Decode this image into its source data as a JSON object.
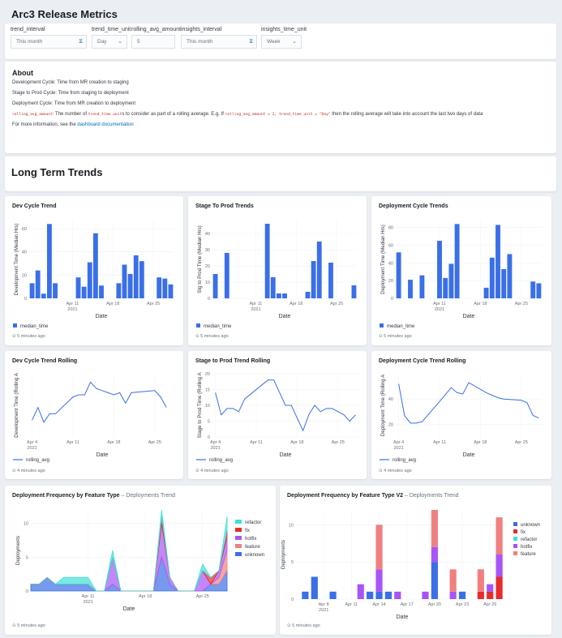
{
  "app_title": "Arc3 Release Metrics",
  "controls": [
    {
      "label": "trend_interval",
      "value": "This month",
      "kind": "date"
    },
    {
      "label": "trend_time_unit",
      "value": "Day",
      "kind": "select"
    },
    {
      "label": "rolling_avg_amount",
      "value": "5",
      "kind": "number"
    },
    {
      "label": "insights_interval",
      "value": "This month",
      "kind": "date"
    },
    {
      "label": "insights_time_unit",
      "value": "Week",
      "kind": "select"
    }
  ],
  "about": {
    "heading": "About",
    "line1": "Development Cycle: Time from MR creation to staging",
    "line2": "Stage to Prod Cycle: Time from staging to deployment",
    "line3": "Deployment Cycle: Time from MR creation to deployment",
    "code1": "rolling_avg_amount",
    "line4a": ": The number of ",
    "code2": "trend_time_unit",
    "line4b": "s to consider as part of a rolling average. E.g. If ",
    "code3": "rolling_avg_amount = 2, trend_time_unit = \"Day\"",
    "line4c": " then the rolling average will take into account the last two days of data",
    "line5a": "For more information, see the ",
    "link": "dashboard documentation"
  },
  "section_title": "Long Term Trends",
  "icons": {
    "date": "calendar-icon",
    "select": "chevron-down-icon",
    "time": "clock-icon"
  },
  "colors": {
    "bar": "#3a6fe8",
    "line": "#3a6fe8",
    "refactor": "#40e0d8",
    "fix": "#e62c2c",
    "hotfix": "#a855f7",
    "feature": "#f08080",
    "unknown": "#3a6fe8"
  },
  "charts": [
    {
      "title": "Dev Cycle Trend",
      "foot": "5 minutes ago",
      "ylabel": "Development Time (Median Hrs)",
      "xlabel": "Date",
      "legend": "median_time",
      "ticks": [
        0,
        20,
        40,
        60
      ],
      "chart_data": {
        "type": "bar",
        "x": [
          "2021-04-04",
          "2021-04-05",
          "2021-04-06",
          "2021-04-07",
          "2021-04-08",
          "2021-04-09",
          "2021-04-10",
          "2021-04-11",
          "2021-04-12",
          "2021-04-13",
          "2021-04-14",
          "2021-04-15",
          "2021-04-16",
          "2021-04-17",
          "2021-04-18",
          "2021-04-19",
          "2021-04-20",
          "2021-04-21",
          "2021-04-22",
          "2021-04-23",
          "2021-04-24",
          "2021-04-25",
          "2021-04-26",
          "2021-04-27",
          "2021-04-28"
        ],
        "values": [
          13,
          24,
          4,
          64,
          13,
          0,
          0,
          0,
          18,
          10,
          31,
          56,
          11,
          0,
          0,
          13,
          29,
          21,
          37,
          32,
          0,
          0,
          18,
          17,
          12
        ],
        "ylim": [
          0,
          67
        ]
      }
    },
    {
      "title": "Stage To Prod Trends",
      "foot": "5 minutes ago",
      "ylabel": "Stg to Prod Time (Median Hrs)",
      "xlabel": "Date",
      "legend": "median_time",
      "ticks": [
        0,
        10,
        20,
        30,
        40
      ],
      "chart_data": {
        "type": "bar",
        "x": [
          "2021-04-04",
          "2021-04-05",
          "2021-04-06",
          "2021-04-07",
          "2021-04-08",
          "2021-04-09",
          "2021-04-10",
          "2021-04-11",
          "2021-04-12",
          "2021-04-13",
          "2021-04-14",
          "2021-04-15",
          "2021-04-16",
          "2021-04-17",
          "2021-04-18",
          "2021-04-19",
          "2021-04-20",
          "2021-04-21",
          "2021-04-22",
          "2021-04-23",
          "2021-04-24",
          "2021-04-25",
          "2021-04-26",
          "2021-04-27",
          "2021-04-28"
        ],
        "values": [
          15,
          0,
          28,
          0,
          0,
          0,
          0,
          0,
          0,
          46,
          13,
          3,
          3,
          0,
          0,
          0,
          4,
          23,
          35,
          0,
          22,
          0,
          0,
          0,
          8
        ],
        "ylim": [
          0,
          48
        ]
      }
    },
    {
      "title": "Deployment Cycle Trends",
      "foot": "5 minutes ago",
      "ylabel": "Deployment Time (Median Hrs)",
      "xlabel": "Date",
      "legend": "median_time",
      "ticks": [
        0,
        20,
        40,
        60,
        80
      ],
      "chart_data": {
        "type": "bar",
        "x": [
          "2021-04-04",
          "2021-04-05",
          "2021-04-06",
          "2021-04-07",
          "2021-04-08",
          "2021-04-09",
          "2021-04-10",
          "2021-04-11",
          "2021-04-12",
          "2021-04-13",
          "2021-04-14",
          "2021-04-15",
          "2021-04-16",
          "2021-04-17",
          "2021-04-18",
          "2021-04-19",
          "2021-04-20",
          "2021-04-21",
          "2021-04-22",
          "2021-04-23",
          "2021-04-24",
          "2021-04-25",
          "2021-04-26",
          "2021-04-27",
          "2021-04-28"
        ],
        "values": [
          52,
          0,
          21,
          0,
          26,
          0,
          0,
          65,
          23,
          39,
          84,
          0,
          0,
          0,
          0,
          12,
          46,
          83,
          33,
          50,
          0,
          0,
          0,
          19,
          17
        ],
        "ylim": [
          0,
          88
        ]
      }
    },
    {
      "title": "Dev Cycle Trend Rolling",
      "foot": "4 minutes ago",
      "ylabel": "Development Time (Rolling A",
      "xlabel": "Date",
      "legend": "rolling_avg",
      "ticks": [],
      "chart_data": {
        "type": "line",
        "x": [
          "2021-04-04",
          "2021-04-05",
          "2021-04-06",
          "2021-04-07",
          "2021-04-08",
          "2021-04-11",
          "2021-04-12",
          "2021-04-13",
          "2021-04-14",
          "2021-04-15",
          "2021-04-18",
          "2021-04-19",
          "2021-04-20",
          "2021-04-21",
          "2021-04-25",
          "2021-04-26",
          "2021-04-27"
        ],
        "values": [
          13,
          19,
          12,
          16,
          16,
          24,
          25,
          25,
          31,
          28,
          25,
          26,
          21,
          26,
          27,
          24,
          19
        ],
        "ylim": [
          5,
          35
        ]
      }
    },
    {
      "title": "Stage to Prod Trend Rolling",
      "foot": "4 minutes ago",
      "ylabel": "Stage to Prod Time (Rolling A",
      "xlabel": "Date",
      "legend": "rolling_avg",
      "ticks": [
        0,
        5,
        10,
        15,
        20
      ],
      "chart_data": {
        "type": "line",
        "x": [
          "2021-04-04",
          "2021-04-05",
          "2021-04-06",
          "2021-04-07",
          "2021-04-08",
          "2021-04-09",
          "2021-04-13",
          "2021-04-14",
          "2021-04-15",
          "2021-04-16",
          "2021-04-17",
          "2021-04-19",
          "2021-04-20",
          "2021-04-21",
          "2021-04-22",
          "2021-04-23",
          "2021-04-24",
          "2021-04-25",
          "2021-04-26",
          "2021-04-27",
          "2021-04-28"
        ],
        "values": [
          14,
          7,
          9,
          9,
          8,
          12,
          18,
          18,
          14,
          10,
          10,
          2,
          7,
          10,
          8,
          9,
          9,
          8,
          7,
          5,
          7
        ],
        "ylim": [
          0,
          20
        ]
      }
    },
    {
      "title": "Deployment Cycle Trend Rolling",
      "foot": "4 minutes ago",
      "ylabel": "Deployment Time (Rolling A",
      "xlabel": "Date",
      "legend": "rolling_avg",
      "ticks": [
        20,
        40
      ],
      "chart_data": {
        "type": "line",
        "x": [
          "2021-04-04",
          "2021-04-05",
          "2021-04-06",
          "2021-04-07",
          "2021-04-08",
          "2021-04-11",
          "2021-04-13",
          "2021-04-14",
          "2021-04-15",
          "2021-04-16",
          "2021-04-19",
          "2021-04-20",
          "2021-04-21",
          "2021-04-22",
          "2021-04-25",
          "2021-04-26",
          "2021-04-27",
          "2021-04-28"
        ],
        "values": [
          52,
          27,
          21,
          21,
          22,
          38,
          49,
          45,
          44,
          53,
          45,
          43,
          41,
          40,
          39,
          37,
          27,
          25
        ],
        "ylim": [
          10,
          60
        ]
      }
    },
    {
      "title": "Deployment Frequency by Feature Type",
      "subtitle": "Deployments Trend",
      "foot": "5 minutes ago",
      "ylabel": "Deployments",
      "xlabel": "Date",
      "ticks": [
        0,
        5,
        10
      ],
      "chart_data": {
        "type": "area",
        "x": [
          "2021-04-04",
          "2021-04-05",
          "2021-04-06",
          "2021-04-07",
          "2021-04-08",
          "2021-04-09",
          "2021-04-10",
          "2021-04-11",
          "2021-04-12",
          "2021-04-13",
          "2021-04-14",
          "2021-04-15",
          "2021-04-16",
          "2021-04-17",
          "2021-04-18",
          "2021-04-19",
          "2021-04-20",
          "2021-04-21",
          "2021-04-22",
          "2021-04-23",
          "2021-04-24",
          "2021-04-25",
          "2021-04-26",
          "2021-04-27",
          "2021-04-28"
        ],
        "series": [
          {
            "name": "unknown",
            "values": [
              1,
              1,
              2,
              1,
              1,
              1,
              1,
              1,
              0,
              0,
              1,
              0,
              0,
              0,
              0,
              0,
              5,
              1,
              0,
              0,
              0,
              0,
              1,
              1,
              3
            ]
          },
          {
            "name": "feature",
            "values": [
              0,
              0,
              0,
              0,
              0,
              0,
              0,
              0,
              0,
              0,
              0,
              0,
              0,
              0,
              0,
              0,
              0,
              0,
              0,
              0,
              0,
              0,
              0,
              1,
              3
            ]
          },
          {
            "name": "hotfix",
            "values": [
              0,
              0,
              0,
              0,
              0,
              0,
              0,
              0,
              0,
              0,
              4,
              0,
              0,
              0,
              0,
              0,
              5,
              1,
              0,
              0,
              0,
              3,
              0,
              1,
              2
            ]
          },
          {
            "name": "fix",
            "values": [
              0,
              0,
              0,
              0,
              0,
              0,
              0,
              0,
              0,
              0,
              0,
              0,
              0,
              0,
              0,
              0,
              1,
              0,
              0,
              0,
              0,
              0,
              1,
              0,
              1
            ]
          },
          {
            "name": "refactor",
            "values": [
              0,
              0,
              0,
              0,
              1,
              1,
              1,
              1,
              0,
              0,
              1,
              0,
              0,
              0,
              0,
              0,
              1,
              0,
              0,
              0,
              0,
              1,
              0,
              0,
              2
            ]
          }
        ],
        "ylim": [
          0,
          12
        ]
      }
    },
    {
      "title": "Deployment Frequency by Feature Type V2",
      "subtitle": "Deployments Trend",
      "foot": "5 minutes ago",
      "ylabel": "Deployments",
      "xlabel": "Date",
      "ticks": [
        0,
        5,
        10
      ],
      "chart_data": {
        "type": "bar",
        "x": [
          "2021-04-06",
          "2021-04-07",
          "2021-04-09",
          "2021-04-12",
          "2021-04-13",
          "2021-04-14",
          "2021-04-15",
          "2021-04-16",
          "2021-04-19",
          "2021-04-20",
          "2021-04-22",
          "2021-04-23",
          "2021-04-25",
          "2021-04-26",
          "2021-04-27"
        ],
        "series": [
          {
            "name": "unknown",
            "values": [
              1,
              3,
              1,
              0,
              1,
              1,
              1,
              0,
              0,
              5,
              0,
              1,
              0,
              0,
              0
            ]
          },
          {
            "name": "fix",
            "values": [
              0,
              0,
              0,
              0,
              0,
              0,
              0,
              0,
              0,
              0,
              0,
              0,
              1,
              1,
              3
            ]
          },
          {
            "name": "refactor",
            "values": [
              0,
              0,
              0,
              0,
              0,
              0,
              0,
              0,
              0,
              0,
              0,
              0,
              0,
              0,
              0
            ]
          },
          {
            "name": "hotfix",
            "values": [
              0,
              0,
              0,
              2,
              0,
              3,
              0,
              1,
              1,
              2,
              1,
              0,
              0,
              1,
              3
            ]
          },
          {
            "name": "feature",
            "values": [
              0,
              0,
              0,
              0,
              0,
              6,
              0,
              0,
              0,
              5,
              3,
              0,
              3,
              0,
              5
            ]
          }
        ],
        "ylim": [
          0,
          12
        ]
      }
    }
  ],
  "legend_types": [
    "refactor",
    "fix",
    "hotfix",
    "feature",
    "unknown"
  ],
  "legend_types_v2": [
    "unknown",
    "fix",
    "refactor",
    "hotfix",
    "feature"
  ],
  "xticks": [
    [
      "Apr 11",
      "Apr 18",
      "Apr 25"
    ],
    [
      "Apr 11",
      "Apr 18",
      "Apr 25"
    ],
    [
      "Apr 11",
      "Apr 18",
      "Apr 25"
    ],
    [
      "Apr 4",
      "Apr 11",
      "Apr 18",
      "Apr 25"
    ],
    [
      "Apr 4",
      "Apr 11",
      "Apr 18",
      "Apr 25"
    ],
    [
      "Apr 4",
      "Apr 11",
      "Apr 18",
      "Apr 25"
    ],
    [
      "Apr 11",
      "Apr 18",
      "Apr 25"
    ],
    [
      "Apr 8",
      "Apr 11",
      "Apr 14",
      "Apr 17",
      "Apr 20",
      "Apr 23",
      "Apr 26"
    ]
  ],
  "year_label": "2021"
}
